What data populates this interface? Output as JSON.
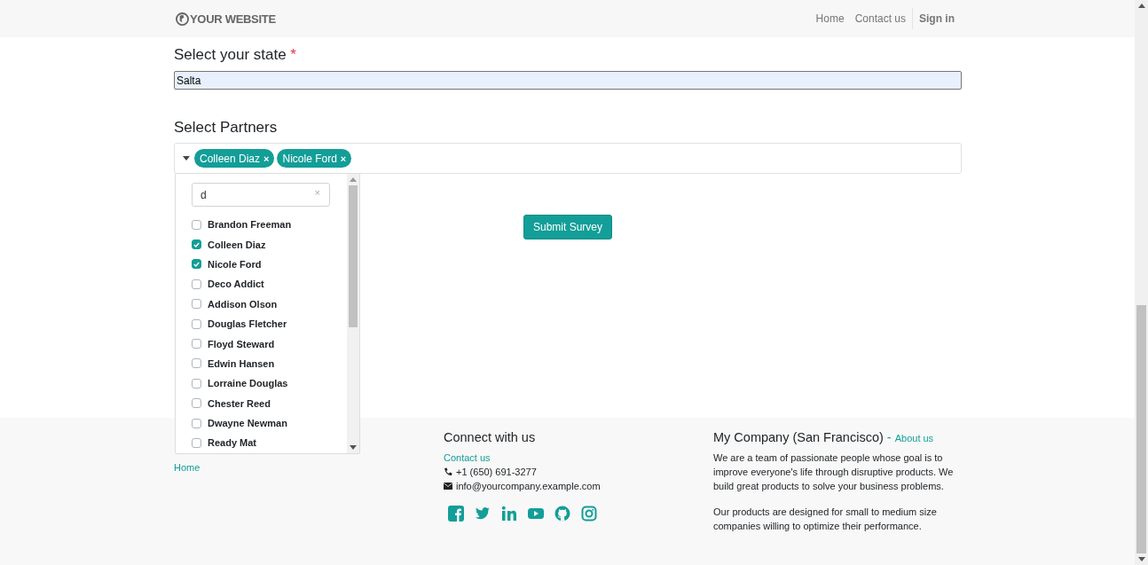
{
  "header": {
    "logo": "YOUR WEBSITE",
    "nav": [
      {
        "label": "Home"
      },
      {
        "label": "Contact us"
      }
    ],
    "sign_in": "Sign in"
  },
  "state_question": {
    "label": "Select your state",
    "required_mark": "*",
    "value": "Salta"
  },
  "partners_question": {
    "label": "Select Partners",
    "tags": [
      {
        "label": "Colleen Diaz",
        "remove": "×"
      },
      {
        "label": "Nicole Ford",
        "remove": "×"
      }
    ],
    "dropdown": {
      "search": "d",
      "clear": "×",
      "options": [
        {
          "label": "Brandon Freeman",
          "checked": false
        },
        {
          "label": "Colleen Diaz",
          "checked": true
        },
        {
          "label": "Nicole Ford",
          "checked": true
        },
        {
          "label": "Deco Addict",
          "checked": false
        },
        {
          "label": "Addison Olson",
          "checked": false
        },
        {
          "label": "Douglas Fletcher",
          "checked": false
        },
        {
          "label": "Floyd Steward",
          "checked": false
        },
        {
          "label": "Edwin Hansen",
          "checked": false
        },
        {
          "label": "Lorraine Douglas",
          "checked": false
        },
        {
          "label": "Chester Reed",
          "checked": false
        },
        {
          "label": "Dwayne Newman",
          "checked": false
        },
        {
          "label": "Ready Mat",
          "checked": false
        }
      ]
    }
  },
  "submit_button": "Submit Survey",
  "footer": {
    "left_links": [
      "Home"
    ],
    "connect": {
      "title": "Connect with us",
      "link": "Contact us",
      "phone": "+1 (650) 691-3277",
      "email": "info@yourcompany.example.com"
    },
    "company": {
      "title": "My Company (San Francisco)",
      "separator": "-",
      "link": "About us",
      "paragraphs": [
        "We are a team of passionate people whose goal is to improve everyone's life through disruptive products. We build great products to solve your business problems.",
        "Our products are designed for small to medium size companies willing to optimize their performance."
      ]
    }
  }
}
